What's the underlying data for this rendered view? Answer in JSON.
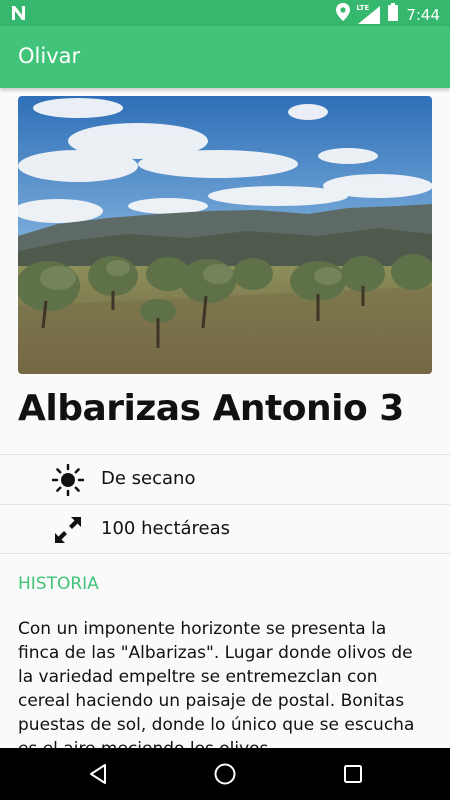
{
  "status_bar": {
    "time": "7:44",
    "network_badge": "LTE",
    "icons": [
      "notification-n-icon",
      "location-icon",
      "signal-icon",
      "battery-icon"
    ]
  },
  "app_bar": {
    "title": "Olivar"
  },
  "farm": {
    "image_desc": "olive-grove-photo",
    "name": "Albarizas Antonio 3",
    "irrigation": {
      "icon": "sun-icon",
      "label": "De secano"
    },
    "area": {
      "icon": "expand-arrows-icon",
      "label": "100 hectáreas"
    }
  },
  "history": {
    "heading": "HISTORIA",
    "text": "Con un imponente horizonte se presenta la finca de las \"Albarizas\". Lugar donde olivos de la variedad empeltre se entremezclan con cereal haciendo un paisaje de postal. Bonitas puestas de sol, donde lo único que se escucha es el aire meciendo los olivos."
  },
  "colors": {
    "primary": "#41c37a",
    "primary_dark": "#35b86d",
    "accent_text": "#41c37a"
  },
  "nav_bar": {
    "buttons": [
      "back-icon",
      "home-icon",
      "recents-icon"
    ]
  }
}
